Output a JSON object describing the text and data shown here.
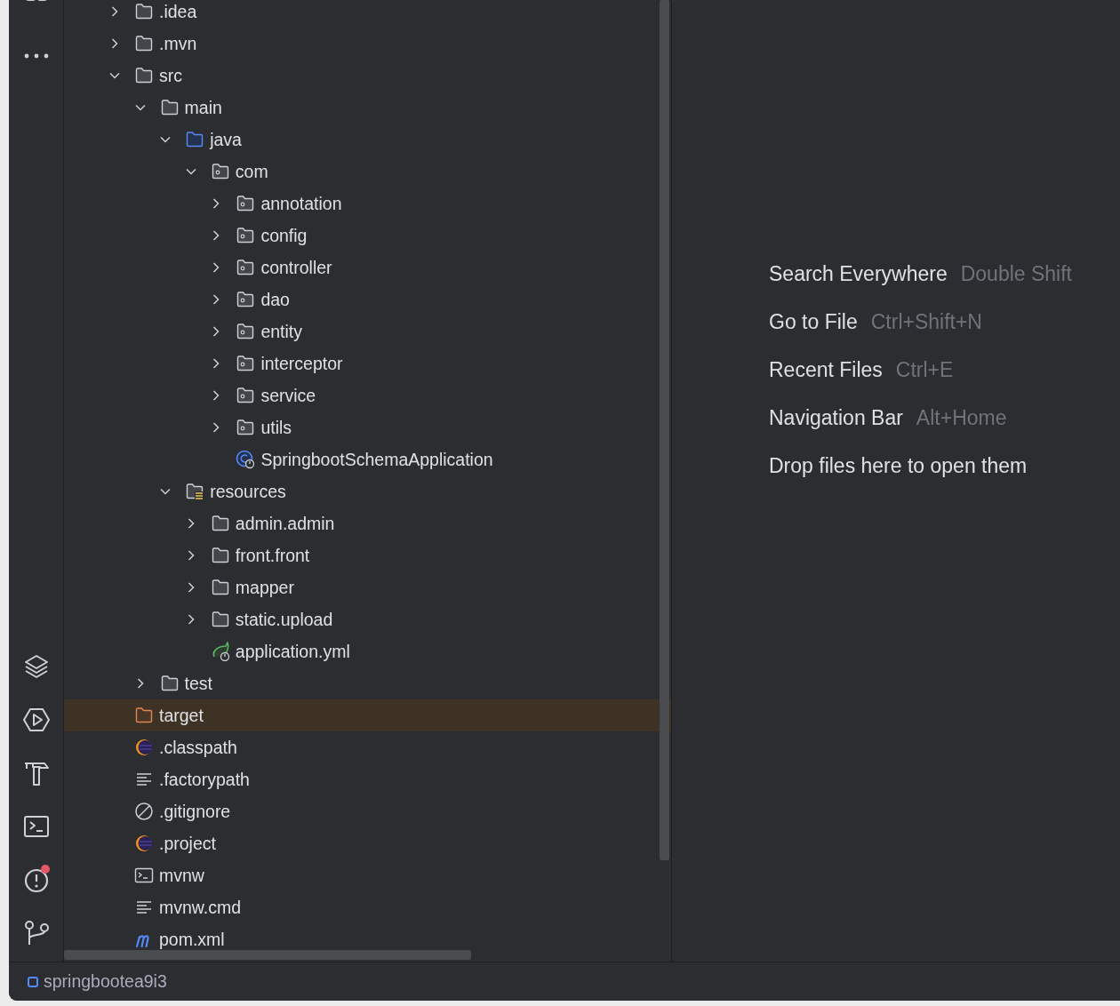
{
  "tool_strip": {
    "top": [
      {
        "kind": "grid"
      },
      {
        "kind": "more"
      }
    ],
    "bottom": [
      {
        "kind": "layers",
        "notification": false
      },
      {
        "kind": "run",
        "notification": false
      },
      {
        "kind": "build",
        "notification": false
      },
      {
        "kind": "terminal",
        "notification": false
      },
      {
        "kind": "problems",
        "notification": true
      },
      {
        "kind": "git",
        "notification": false
      }
    ]
  },
  "project_tree": [
    {
      "label": ".idea",
      "kind": "folder",
      "expanded": false,
      "selected": false
    },
    {
      "label": ".mvn",
      "kind": "folder",
      "expanded": false,
      "selected": false
    },
    {
      "label": "src",
      "kind": "folder",
      "expanded": true,
      "selected": false,
      "children": [
        {
          "label": "main",
          "kind": "folder",
          "expanded": true,
          "selected": false,
          "children": [
            {
              "label": "java",
              "kind": "source-root",
              "expanded": true,
              "selected": false,
              "children": [
                {
                  "label": "com",
                  "kind": "package",
                  "expanded": true,
                  "selected": false,
                  "children": [
                    {
                      "label": "annotation",
                      "kind": "package",
                      "expanded": false,
                      "selected": false
                    },
                    {
                      "label": "config",
                      "kind": "package",
                      "expanded": false,
                      "selected": false
                    },
                    {
                      "label": "controller",
                      "kind": "package",
                      "expanded": false,
                      "selected": false
                    },
                    {
                      "label": "dao",
                      "kind": "package",
                      "expanded": false,
                      "selected": false
                    },
                    {
                      "label": "entity",
                      "kind": "package",
                      "expanded": false,
                      "selected": false
                    },
                    {
                      "label": "interceptor",
                      "kind": "package",
                      "expanded": false,
                      "selected": false
                    },
                    {
                      "label": "service",
                      "kind": "package",
                      "expanded": false,
                      "selected": false
                    },
                    {
                      "label": "utils",
                      "kind": "package",
                      "expanded": false,
                      "selected": false
                    },
                    {
                      "label": "SpringbootSchemaApplication",
                      "kind": "class",
                      "selected": false
                    }
                  ]
                }
              ]
            },
            {
              "label": "resources",
              "kind": "resources",
              "expanded": true,
              "selected": false,
              "children": [
                {
                  "label": "admin.admin",
                  "kind": "folder",
                  "expanded": false,
                  "selected": false
                },
                {
                  "label": "front.front",
                  "kind": "folder",
                  "expanded": false,
                  "selected": false
                },
                {
                  "label": "mapper",
                  "kind": "folder",
                  "expanded": false,
                  "selected": false
                },
                {
                  "label": "static.upload",
                  "kind": "folder",
                  "expanded": false,
                  "selected": false
                },
                {
                  "label": "application.yml",
                  "kind": "spring",
                  "selected": false
                }
              ]
            }
          ]
        },
        {
          "label": "test",
          "kind": "folder",
          "expanded": false,
          "selected": false
        }
      ]
    },
    {
      "label": "target",
      "kind": "excluded",
      "selected": true
    },
    {
      "label": ".classpath",
      "kind": "eclipse",
      "selected": false
    },
    {
      "label": ".factorypath",
      "kind": "text",
      "selected": false
    },
    {
      "label": ".gitignore",
      "kind": "ignore",
      "selected": false
    },
    {
      "label": ".project",
      "kind": "eclipse",
      "selected": false
    },
    {
      "label": "mvnw",
      "kind": "script",
      "selected": false
    },
    {
      "label": "mvnw.cmd",
      "kind": "text",
      "selected": false
    },
    {
      "label": "pom.xml",
      "kind": "maven",
      "selected": false
    }
  ],
  "editor_hints": [
    {
      "action": "Search Everywhere",
      "shortcut": "Double Shift"
    },
    {
      "action": "Go to File",
      "shortcut": "Ctrl+Shift+N"
    },
    {
      "action": "Recent Files",
      "shortcut": "Ctrl+E"
    },
    {
      "action": "Navigation Bar",
      "shortcut": "Alt+Home"
    },
    {
      "action": "Drop files here to open them"
    }
  ],
  "status_bar": {
    "project": "springbootea9i3"
  }
}
